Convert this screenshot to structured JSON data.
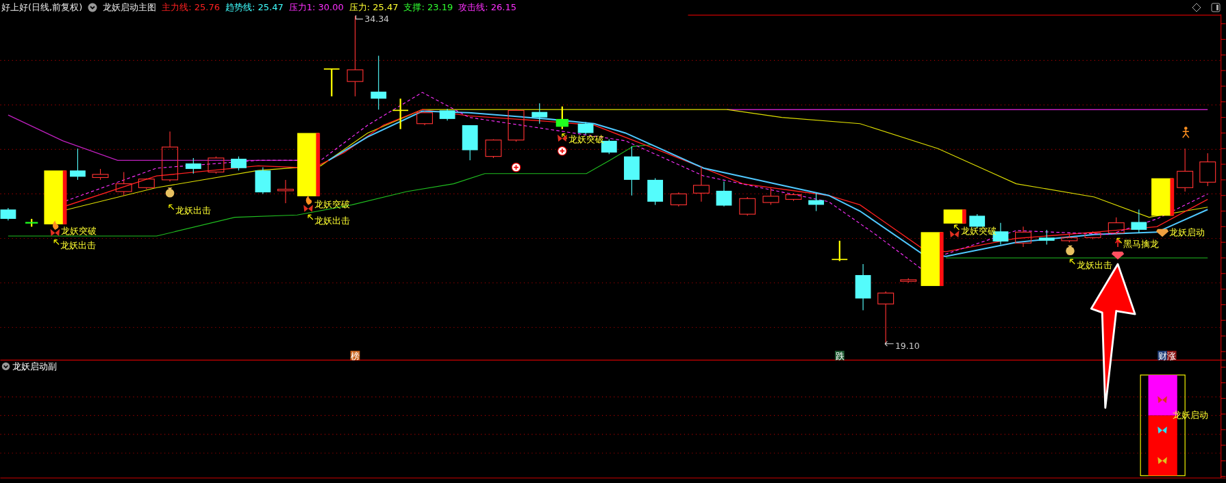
{
  "header": {
    "stock": "好上好(日线,前复权)",
    "indicator": "龙妖启动主图",
    "readings": [
      {
        "text": "主力线: 25.76",
        "color": "#ff2020"
      },
      {
        "text": "趋势线: 25.47",
        "color": "#40ffff"
      },
      {
        "text": "压力1: 30.00",
        "color": "#ff30ff"
      },
      {
        "text": "压力: 25.47",
        "color": "#ffff30"
      },
      {
        "text": "支撑: 23.19",
        "color": "#30ff30"
      },
      {
        "text": "攻击线: 26.15",
        "color": "#ff30ff"
      }
    ]
  },
  "main_chart": {
    "high_mark": "34.34",
    "low_mark": "19.10",
    "signals": [
      {
        "text": "龙妖突破",
        "pointer": false
      },
      {
        "text": "龙妖出击",
        "pointer": true
      },
      {
        "text": "龙妖出击",
        "pointer": true
      },
      {
        "text": "龙妖突破",
        "pointer": false
      },
      {
        "text": "龙妖出击",
        "pointer": true
      },
      {
        "text": "龙妖突破",
        "pointer": true
      },
      {
        "text": "龙妖突破",
        "pointer": true
      },
      {
        "text": "黑马擒龙",
        "pointer": true
      },
      {
        "text": "龙妖启动",
        "pointer": false
      },
      {
        "text": "龙妖出击",
        "pointer": true
      }
    ],
    "badges": [
      {
        "text": "榜",
        "color": "#c8641e"
      },
      {
        "text": "跌",
        "color": "#1e5a32"
      },
      {
        "text": "财",
        "color": "#1e3c78"
      },
      {
        "text": "涨",
        "color": "#8c1414"
      }
    ]
  },
  "sub_panel": {
    "title": "龙妖启动副",
    "label": "龙妖启动"
  }
}
